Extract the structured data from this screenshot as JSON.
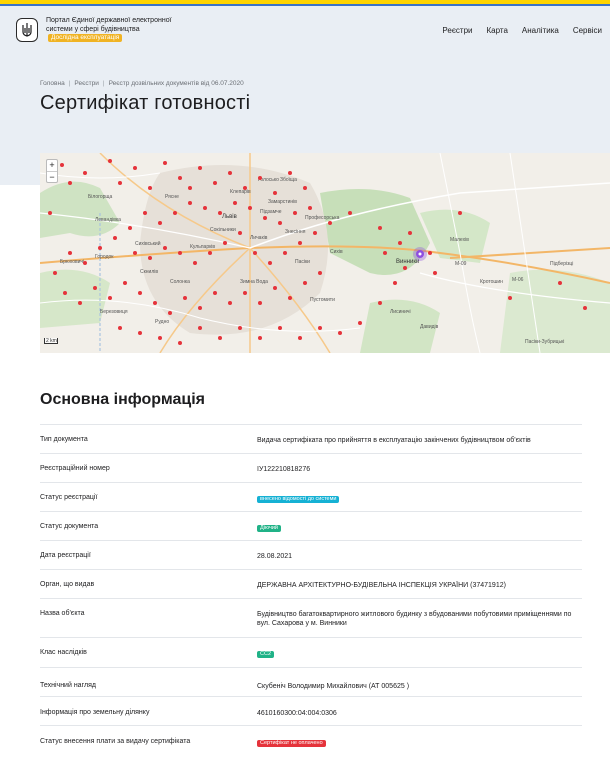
{
  "header": {
    "brand_text": "Портал Єдиної державної електронної системи у сфері будівництва",
    "beta_badge": "Дослідна експлуатація",
    "nav": [
      "Реєстри",
      "Карта",
      "Аналітика",
      "Сервіси"
    ]
  },
  "breadcrumbs": [
    "Головна",
    "Реєстри",
    "Реєстр дозвільних документів від 06.07.2020"
  ],
  "page_title": "Сертифікат готовності",
  "map": {
    "zoom_in": "+",
    "zoom_out": "−",
    "scale": "2 km",
    "labels": [
      "Білогорща",
      "Брюховичі",
      "Рудно",
      "Рясне",
      "Голосько",
      "Збоїща",
      "Клепарів",
      "Замарстинів",
      "Підзамче",
      "Знесіння",
      "Професорська",
      "Львів",
      "Личаків",
      "Сокільники",
      "Кульпарків",
      "Сихів",
      "Винники",
      "Лисиничі",
      "Пасіки-Зубрицькі",
      "Солонка",
      "Зимна Вода",
      "Малехів",
      "Кротошин",
      "Пустомити",
      "Березовиця",
      "Давидів",
      "М-09",
      "М-06",
      "Городок",
      "Скнилів",
      "Левандівка",
      "Сихівський",
      "Підберізці",
      "Пасіки"
    ],
    "marker_color": "#e5333b",
    "selected_marker_color": "#8f4fe0"
  },
  "section_title": "Основна інформація",
  "info_rows": [
    {
      "label": "Тип документа",
      "value": "Видача сертифіката про прийняття в експлуатацію закінчених будівництвом об'єктів"
    },
    {
      "label": "Реєстраційний номер",
      "value": "ІУ122210818276"
    },
    {
      "label": "Статус реєстрації",
      "value": "внесено відомості до системи",
      "pill": "cyan"
    },
    {
      "label": "Статус документа",
      "value": "Діючий",
      "pill": "green"
    },
    {
      "label": "Дата реєстрації",
      "value": "28.08.2021"
    },
    {
      "label": "Орган, що видав",
      "value": "ДЕРЖАВНА АРХІТЕКТУРНО-БУДІВЕЛЬНА ІНСПЕКЦІЯ УКРАЇНИ (37471912)"
    },
    {
      "label": "Назва об'єкта",
      "value": "Будівництво багатоквартирного житлового будинку з вбудованими побутовими приміщеннями по вул. Сахарова у м. Винники"
    },
    {
      "label": "Клас наслідків",
      "value": "СС2",
      "pill": "green"
    },
    {
      "label": "Технічний нагляд",
      "value": "Скубеніч Володимир Михайлович (АТ 005625 )"
    },
    {
      "label": "Інформація про земельну ділянку",
      "value": "4610160300:04:004:0306"
    },
    {
      "label": "Статус внесення плати за видачу сертифіката",
      "value": "Сертифікат не оплачено",
      "pill": "red"
    }
  ]
}
